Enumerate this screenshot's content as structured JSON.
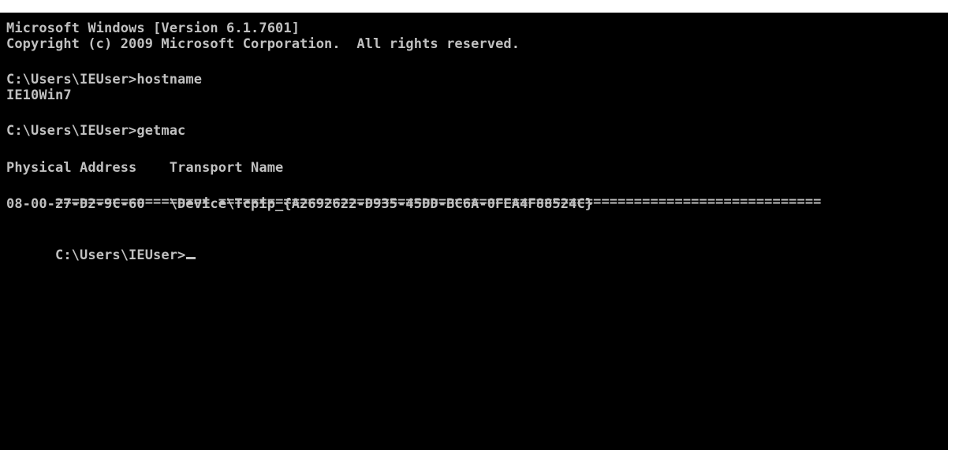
{
  "console": {
    "lines": [
      "Microsoft Windows [Version 6.1.7601]",
      "Copyright (c) 2009 Microsoft Corporation.  All rights reserved.",
      "C:\\Users\\IEUser>hostname",
      "IE10Win7",
      "C:\\Users\\IEUser>getmac",
      "Physical Address    Transport Name",
      "08-00-27-D2-9C-60   \\Device\\Tcpip_{A2692622-D935-45DD-BC6A-0FEA4F88524C}",
      "C:\\Users\\IEUser>"
    ],
    "separator_left": "===================",
    "separator_right": "=========================================================================="
  },
  "colors": {
    "background": "#000000",
    "text": "#c0c0c0"
  }
}
